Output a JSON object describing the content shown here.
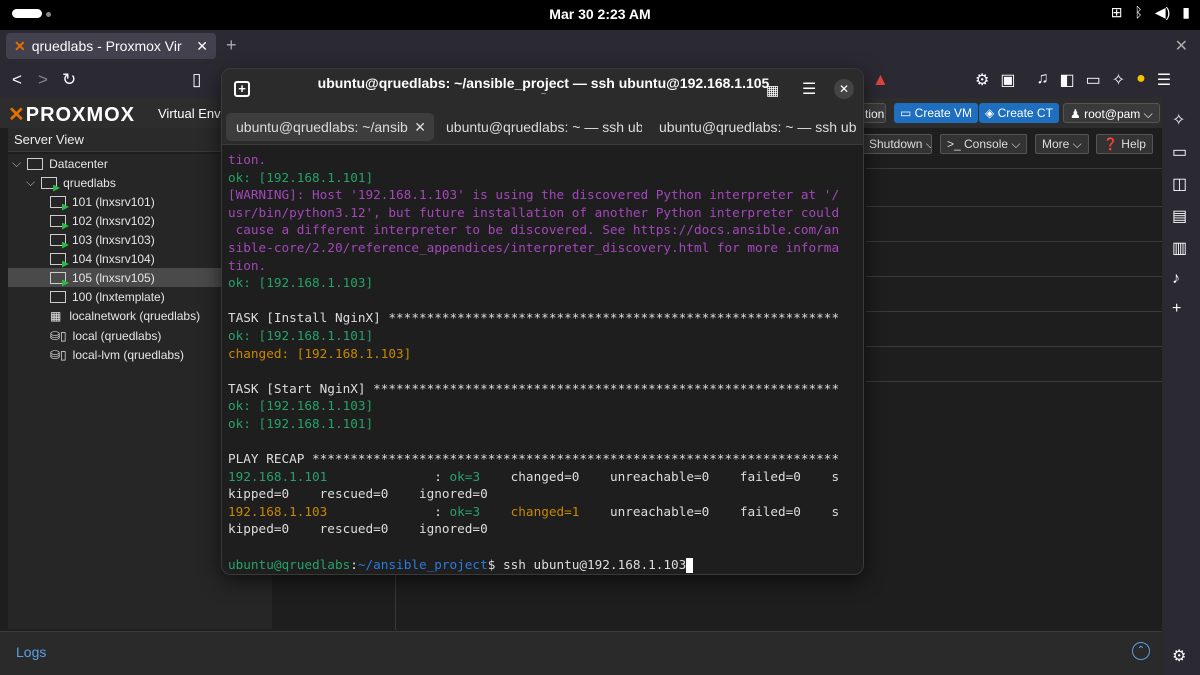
{
  "topbar": {
    "clock": "Mar 30   2:23 AM",
    "tray": [
      "network-icon",
      "bluetooth-icon",
      "volume-icon",
      "battery-icon"
    ]
  },
  "browser": {
    "tab_title": "qruedlabs - Proxmox Vir",
    "tab_close": "✕",
    "new_tab": "+",
    "window_close": "✕"
  },
  "proxmox": {
    "logo_text": "PROXMOX",
    "logo_sub": "Virtual Envi",
    "header_buttons": {
      "doc_partial": "tion",
      "create_vm": "Create VM",
      "create_ct": "Create CT",
      "user": "root@pam ⌵"
    },
    "toolbar": {
      "shutdown": "Shutdown ⌵",
      "console": ">_ Console ⌵",
      "more": "More ⌵",
      "help": "Help"
    },
    "server_view": "Server View",
    "tree": [
      {
        "label": "Datacenter",
        "type": "datacenter"
      },
      {
        "label": "qruedlabs",
        "type": "node"
      },
      {
        "label": "101 (lnxsrv101)",
        "type": "vm"
      },
      {
        "label": "102 (lnxsrv102)",
        "type": "vm"
      },
      {
        "label": "103 (lnxsrv103)",
        "type": "vm"
      },
      {
        "label": "104 (lnxsrv104)",
        "type": "vm"
      },
      {
        "label": "105 (lnxsrv105)",
        "type": "vm",
        "selected": true
      },
      {
        "label": "100 (lnxtemplate)",
        "type": "template"
      },
      {
        "label": "localnetwork (qruedlabs)",
        "type": "network"
      },
      {
        "label": "local (qruedlabs)",
        "type": "storage"
      },
      {
        "label": "local-lvm (qruedlabs)",
        "type": "storage"
      }
    ],
    "logs_label": "Logs"
  },
  "terminal": {
    "title": "ubuntu@qruedlabs: ~/ansible_project — ssh ubuntu@192.168.1.105",
    "subtitle": "~",
    "tabs": [
      "ubuntu@qruedlabs: ~/ansib",
      "ubuntu@qruedlabs: ~ — ssh ub",
      "ubuntu@qruedlabs: ~ — ssh ub"
    ],
    "lines": [
      [
        {
          "c": "p",
          "t": "tion."
        }
      ],
      [
        {
          "c": "g",
          "t": "ok: [192.168.1.101]"
        }
      ],
      [
        {
          "c": "p",
          "t": "[WARNING]: Host '192.168.1.103' is using the discovered Python interpreter at '/"
        }
      ],
      [
        {
          "c": "p",
          "t": "usr/bin/python3.12', but future installation of another Python interpreter could"
        }
      ],
      [
        {
          "c": "p",
          "t": " cause a different interpreter to be discovered. See https://docs.ansible.com/an"
        }
      ],
      [
        {
          "c": "p",
          "t": "sible-core/2.20/reference_appendices/interpreter_discovery.html for more informa"
        }
      ],
      [
        {
          "c": "p",
          "t": "tion."
        }
      ],
      [
        {
          "c": "g",
          "t": "ok: [192.168.1.103]"
        }
      ],
      [
        {
          "c": "w",
          "t": ""
        }
      ],
      [
        {
          "c": "w",
          "t": "TASK [Install NginX] ***********************************************************"
        }
      ],
      [
        {
          "c": "g",
          "t": "ok: [192.168.1.101]"
        }
      ],
      [
        {
          "c": "y",
          "t": "changed: [192.168.1.103]"
        }
      ],
      [
        {
          "c": "w",
          "t": ""
        }
      ],
      [
        {
          "c": "w",
          "t": "TASK [Start NginX] *************************************************************"
        }
      ],
      [
        {
          "c": "g",
          "t": "ok: [192.168.1.103]"
        }
      ],
      [
        {
          "c": "g",
          "t": "ok: [192.168.1.101]"
        }
      ],
      [
        {
          "c": "w",
          "t": ""
        }
      ],
      [
        {
          "c": "w",
          "t": "PLAY RECAP *********************************************************************"
        }
      ],
      [
        {
          "c": "g",
          "t": "192.168.1.101"
        },
        {
          "c": "w",
          "t": "              : "
        },
        {
          "c": "g",
          "t": "ok=3"
        },
        {
          "c": "w",
          "t": "    changed=0    unreachable=0    failed=0    s"
        }
      ],
      [
        {
          "c": "w",
          "t": "kipped=0    rescued=0    ignored=0"
        }
      ],
      [
        {
          "c": "y",
          "t": "192.168.1.103"
        },
        {
          "c": "w",
          "t": "              : "
        },
        {
          "c": "g",
          "t": "ok=3"
        },
        {
          "c": "w",
          "t": "    "
        },
        {
          "c": "y",
          "t": "changed=1"
        },
        {
          "c": "w",
          "t": "    unreachable=0    failed=0    s"
        }
      ],
      [
        {
          "c": "w",
          "t": "kipped=0    rescued=0    ignored=0"
        }
      ],
      [
        {
          "c": "w",
          "t": ""
        }
      ],
      [
        {
          "c": "g",
          "t": "ubuntu@qruedlabs"
        },
        {
          "c": "w",
          "t": ":"
        },
        {
          "c": "b",
          "t": "~/ansible_project"
        },
        {
          "c": "w",
          "t": "$ ssh ubuntu@192.168.1.103"
        }
      ]
    ]
  }
}
